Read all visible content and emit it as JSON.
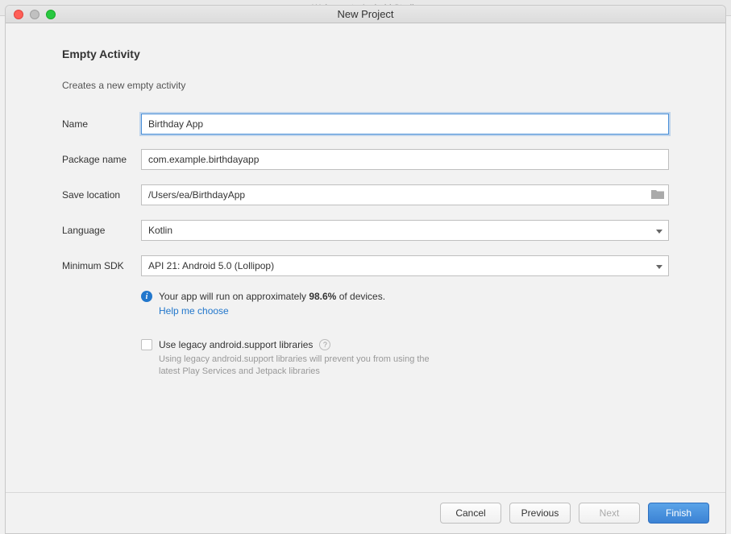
{
  "background_window_title": "Welcome to Android Studio",
  "window": {
    "title": "New Project"
  },
  "form": {
    "heading": "Empty Activity",
    "subheading": "Creates a new empty activity",
    "name_label": "Name",
    "name_value": "Birthday App",
    "package_label": "Package name",
    "package_value": "com.example.birthdayapp",
    "save_label": "Save location",
    "save_value": "/Users/ea/BirthdayApp",
    "language_label": "Language",
    "language_value": "Kotlin",
    "sdk_label": "Minimum SDK",
    "sdk_value": "API 21: Android 5.0 (Lollipop)",
    "info_prefix": "Your app will run on approximately ",
    "info_percent": "98.6%",
    "info_suffix": " of devices.",
    "help_link": "Help me choose",
    "legacy_label": "Use legacy android.support libraries",
    "legacy_desc": "Using legacy android.support libraries will prevent you from using the latest Play Services and Jetpack libraries"
  },
  "buttons": {
    "cancel": "Cancel",
    "previous": "Previous",
    "next": "Next",
    "finish": "Finish"
  }
}
